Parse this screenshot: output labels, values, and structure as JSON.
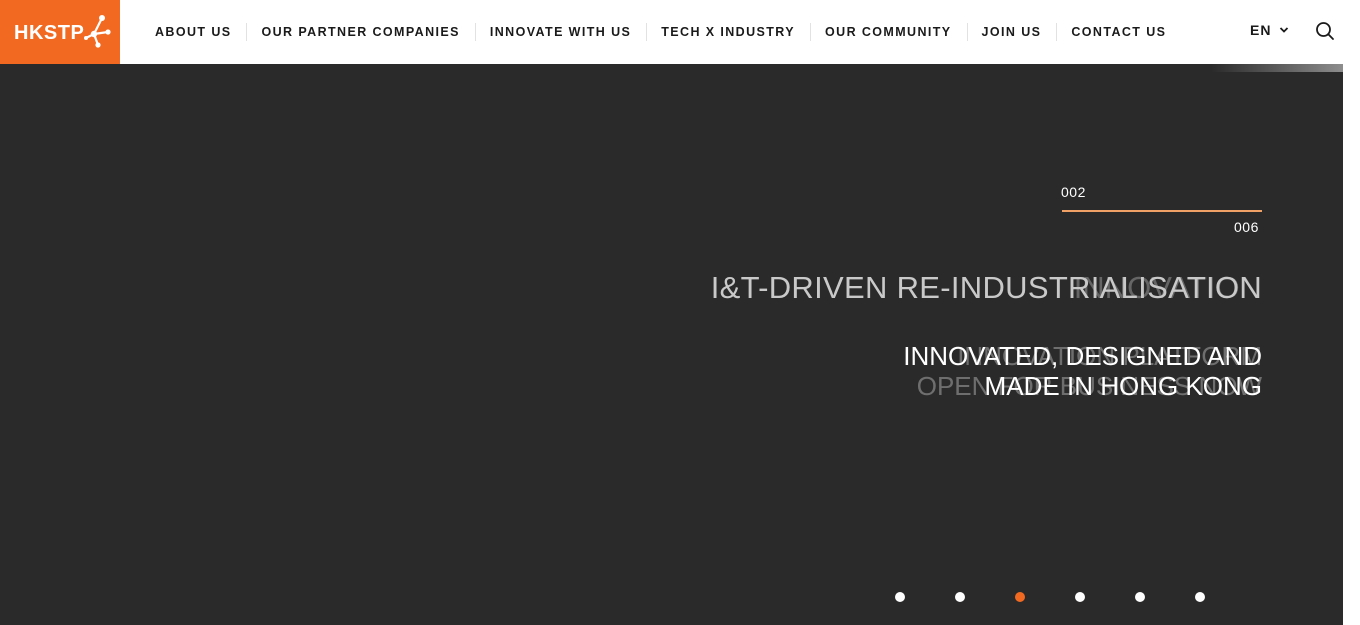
{
  "brand": {
    "logo_text": "HKSTP",
    "accent_color": "#f26a21",
    "underline_color": "#1f3a8c"
  },
  "nav": {
    "items": [
      {
        "label": "ABOUT US"
      },
      {
        "label": "OUR PARTNER COMPANIES"
      },
      {
        "label": "INNOVATE WITH US"
      },
      {
        "label": "TECH X INDUSTRY"
      },
      {
        "label": "OUR COMMUNITY"
      },
      {
        "label": "JOIN US"
      },
      {
        "label": "CONTACT US"
      }
    ],
    "language": "EN",
    "language_icon": "chevron-down-icon",
    "search_icon": "search-icon"
  },
  "hero": {
    "current_slide": "002",
    "total_slides": "006",
    "headline": "I&T-DRIVEN RE-INDUSTRIALISATION",
    "headline_ghost": "INNOVATION",
    "subline_1": "INNOVATED, DESIGNED AND",
    "subline_2": "MADE IN HONG KONG",
    "subline_ghost_1": "INNOVATION PLATFORM",
    "subline_ghost_2": "OPEN FOR BUSINESS NOW",
    "background_color": "#2a2a2a",
    "slide_count": 6,
    "active_dot_index": 2
  }
}
